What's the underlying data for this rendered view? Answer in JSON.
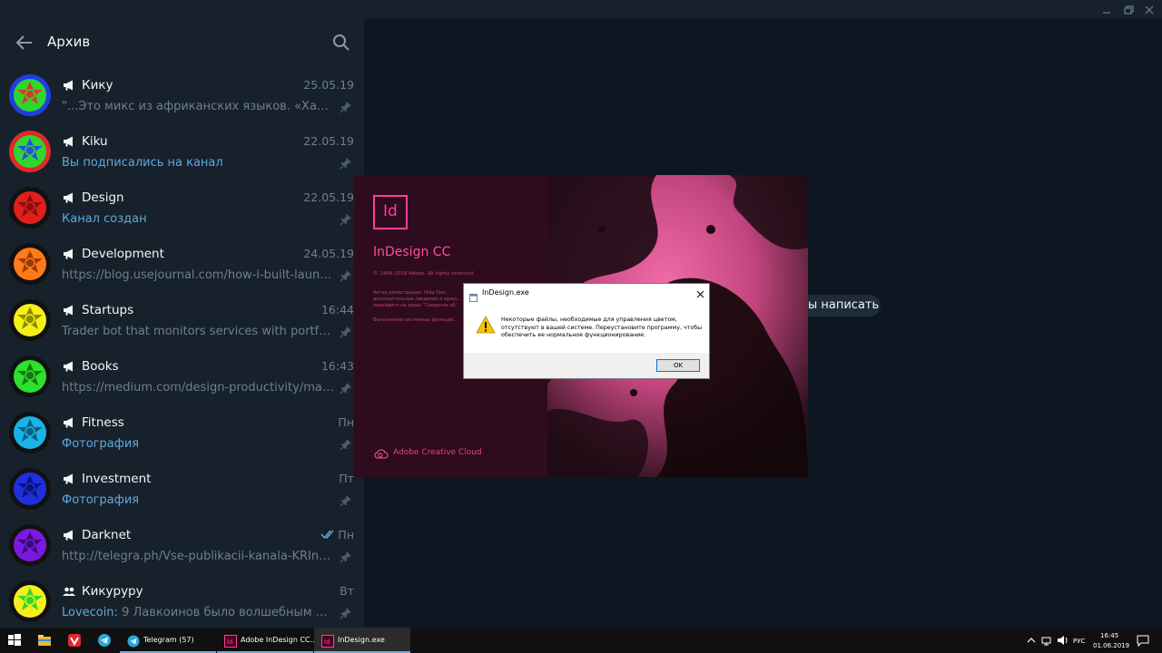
{
  "telegram": {
    "sidebar": {
      "title": "Архив",
      "chats": [
        {
          "name": "Кику",
          "type": "channel",
          "date": "25.05.19",
          "preview": "\"...Это микс из африканских языков. «Хафанан...",
          "preview_style": "muted",
          "pinned": true,
          "avatar_outer": "#1f3fe0",
          "avatar_inner": "#2fd62f",
          "avatar_emblem": "#d63a2a"
        },
        {
          "name": "Kiku",
          "type": "channel",
          "date": "22.05.19",
          "preview": "Вы подписались на канал",
          "preview_style": "accent",
          "pinned": true,
          "avatar_outer": "#e02a2a",
          "avatar_inner": "#2fd62f",
          "avatar_emblem": "#2a4fe0"
        },
        {
          "name": "Design",
          "type": "channel",
          "date": "22.05.19",
          "preview": "Канал создан",
          "preview_style": "accent",
          "pinned": true,
          "avatar_outer": "#111111",
          "avatar_inner": "#e0201c",
          "avatar_emblem": "#8b0d0d"
        },
        {
          "name": "Development",
          "type": "channel",
          "date": "24.05.19",
          "preview": "https://blog.usejournal.com/how-i-built-launche...",
          "preview_style": "muted",
          "pinned": true,
          "avatar_outer": "#111111",
          "avatar_inner": "#ff7a1a",
          "avatar_emblem": "#9a3c00"
        },
        {
          "name": "Startups",
          "type": "channel",
          "date": "16:44",
          "preview": "Trader bot that monitors services with portfolio...",
          "preview_style": "muted",
          "pinned": true,
          "avatar_outer": "#111111",
          "avatar_inner": "#f5f01a",
          "avatar_emblem": "#8a8a00"
        },
        {
          "name": "Books",
          "type": "channel",
          "date": "16:43",
          "preview": "https://medium.com/design-productivity/make-...",
          "preview_style": "muted",
          "pinned": true,
          "avatar_outer": "#111111",
          "avatar_inner": "#2fe02f",
          "avatar_emblem": "#0f7a0f"
        },
        {
          "name": "Fitness",
          "type": "channel",
          "date": "Пн",
          "preview": "Фотография",
          "preview_style": "accent",
          "pinned": true,
          "avatar_outer": "#111111",
          "avatar_inner": "#1ab2e8",
          "avatar_emblem": "#0a5f82"
        },
        {
          "name": "Investment",
          "type": "channel",
          "date": "Пт",
          "preview": "Фотография",
          "preview_style": "accent",
          "pinned": true,
          "avatar_outer": "#111111",
          "avatar_inner": "#1f2fe0",
          "avatar_emblem": "#0c147a"
        },
        {
          "name": "Darknet",
          "type": "channel",
          "date": "Пн",
          "preview": "http://telegra.ph/Vse-publikacii-kanala-KRIncog...",
          "preview_style": "muted",
          "pinned": true,
          "read": true,
          "avatar_outer": "#111111",
          "avatar_inner": "#7a1ae0",
          "avatar_emblem": "#3c0a75"
        },
        {
          "name": "Кикуруру",
          "type": "group",
          "date": "Вт",
          "preview_sender": "Lovecoin:",
          "preview": " 9 Лавкоинов было волшебным обра...",
          "preview_style": "muted",
          "pinned": true,
          "avatar_outer": "#111111",
          "avatar_inner": "#f5f01a",
          "avatar_emblem": "#2fd62f"
        }
      ]
    },
    "main_hint": "ы написать"
  },
  "indesign_splash": {
    "logo": "Id",
    "title": "InDesign CC",
    "copyright": "© 1999-2018 Adobe. All rights reserved.",
    "credit": "Автор иллюстрации: Hida Diac...",
    "credit_more": "дополнительных сведений и юрид... перейдите на экран \"Сведения об...",
    "status": "Выполнение системных функций...",
    "footer": "Adobe Creative Cloud"
  },
  "dialog": {
    "title": "InDesign.exe",
    "message": "Некоторые файлы, необходимые для управления цветом, отсутствуют в вашей системе. Переустановите программу, чтобы обеспечить ее нормальное функционирование.",
    "ok_label": "OK"
  },
  "taskbar": {
    "tasks": [
      {
        "label": "Telegram (57)"
      },
      {
        "label": "Adobe InDesign CC..."
      },
      {
        "label": "InDesign.exe"
      }
    ],
    "language": "РУС",
    "time": "16:45",
    "date": "01.06.2019"
  },
  "colors": {
    "sidebar_bg": "#17212b",
    "main_bg": "#0e1621",
    "accent_text": "#5ea9dd",
    "muted_text": "#6d7f8f",
    "indesign_pink": "#ff3e9a"
  }
}
